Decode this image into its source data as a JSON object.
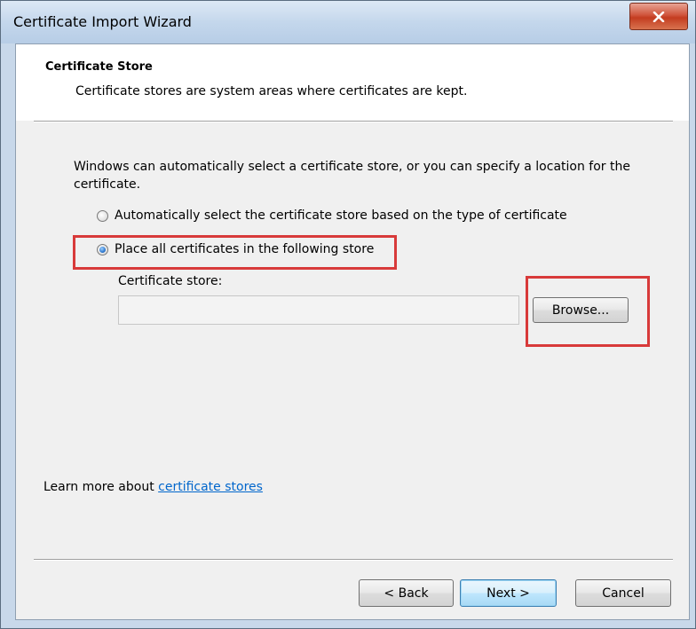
{
  "window": {
    "title": "Certificate Import Wizard",
    "close_label": "x"
  },
  "header": {
    "title": "Certificate Store",
    "subtitle": "Certificate stores are system areas where certificates are kept."
  },
  "body": {
    "description": "Windows can automatically select a certificate store, or you can specify a location for the certificate.",
    "options": [
      {
        "label": "Automatically select the certificate store based on the type of certificate",
        "selected": false
      },
      {
        "label": "Place all certificates in the following store",
        "selected": true
      }
    ],
    "store_label": "Certificate store:",
    "store_value": "",
    "browse_label": "Browse..."
  },
  "footer": {
    "learn_prefix": "Learn more about ",
    "learn_link": "certificate stores",
    "back_label": "< Back",
    "next_label": "Next >",
    "cancel_label": "Cancel"
  },
  "colors": {
    "highlight": "#d83a3a",
    "link": "#0066cc"
  }
}
